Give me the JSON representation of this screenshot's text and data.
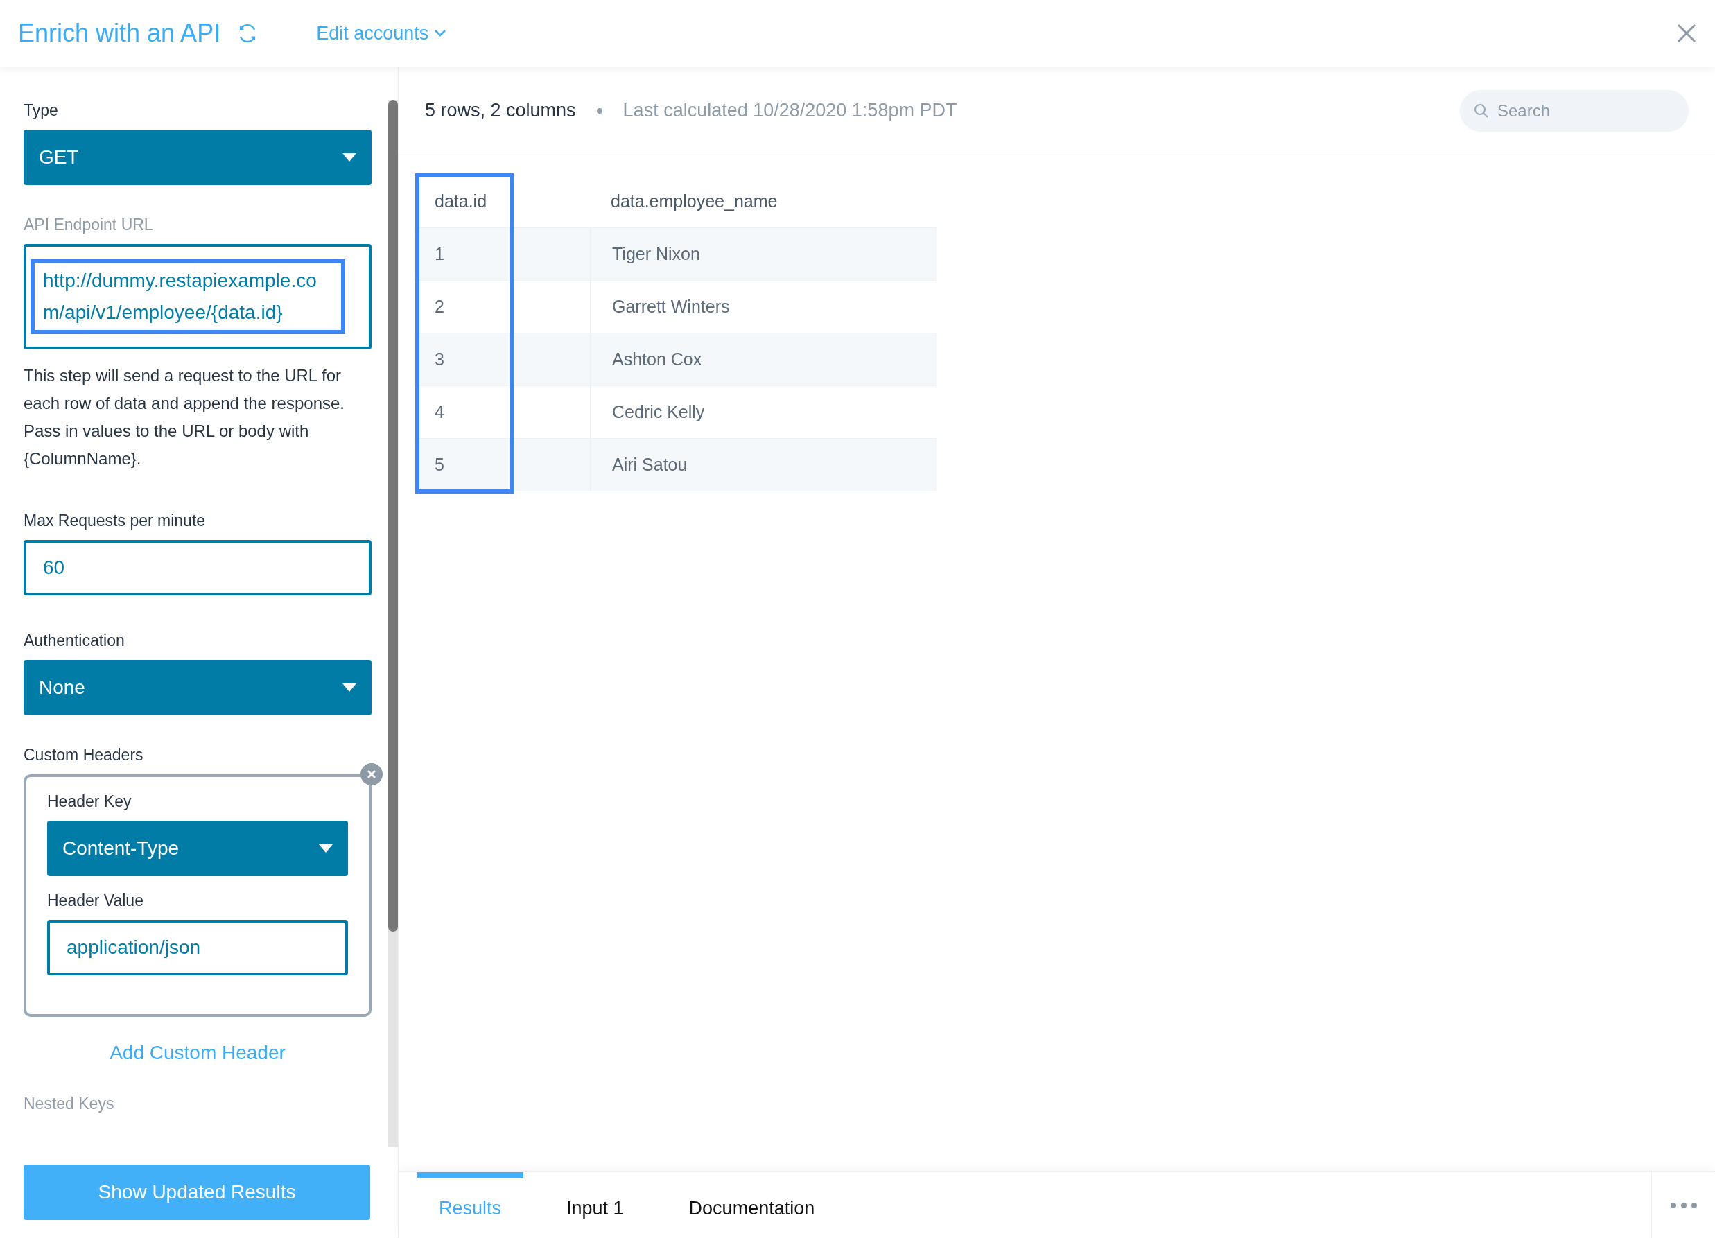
{
  "header": {
    "title": "Enrich with an API",
    "accounts_menu": "Edit accounts"
  },
  "settings": {
    "type": {
      "label": "Type",
      "value": "GET"
    },
    "endpoint": {
      "label": "API Endpoint URL",
      "value": "http://dummy.restapiexample.com/api/v1/employee/{data.id}",
      "highlighted": true
    },
    "description": "This step will send a request to the URL for each row of data and append the response. Pass in values to the URL or body with {ColumnName}.",
    "max_requests": {
      "label": "Max Requests per minute",
      "value": "60"
    },
    "authentication": {
      "label": "Authentication",
      "value": "None"
    },
    "custom_headers": {
      "label": "Custom Headers",
      "items": [
        {
          "key_label": "Header Key",
          "key": "Content-Type",
          "value_label": "Header Value",
          "value": "application/json"
        }
      ],
      "add_link": "Add Custom Header"
    },
    "nested_keys": {
      "label": "Nested Keys"
    },
    "submit": "Show Updated Results"
  },
  "results": {
    "summary": "5 rows, 2 columns",
    "last_calculated": "Last calculated 10/28/2020 1:58pm PDT",
    "search": {
      "placeholder": "Search"
    },
    "columns": [
      {
        "label": "data.id",
        "highlighted": true
      },
      {
        "label": "data.employee_name",
        "highlighted": false
      }
    ],
    "rows": [
      [
        "1",
        "Tiger Nixon"
      ],
      [
        "2",
        "Garrett Winters"
      ],
      [
        "3",
        "Ashton Cox"
      ],
      [
        "4",
        "Cedric Kelly"
      ],
      [
        "5",
        "Airi Satou"
      ]
    ]
  },
  "tabs": [
    {
      "label": "Results",
      "selected": true
    },
    {
      "label": "Input 1",
      "selected": false
    },
    {
      "label": "Documentation",
      "selected": false
    }
  ]
}
